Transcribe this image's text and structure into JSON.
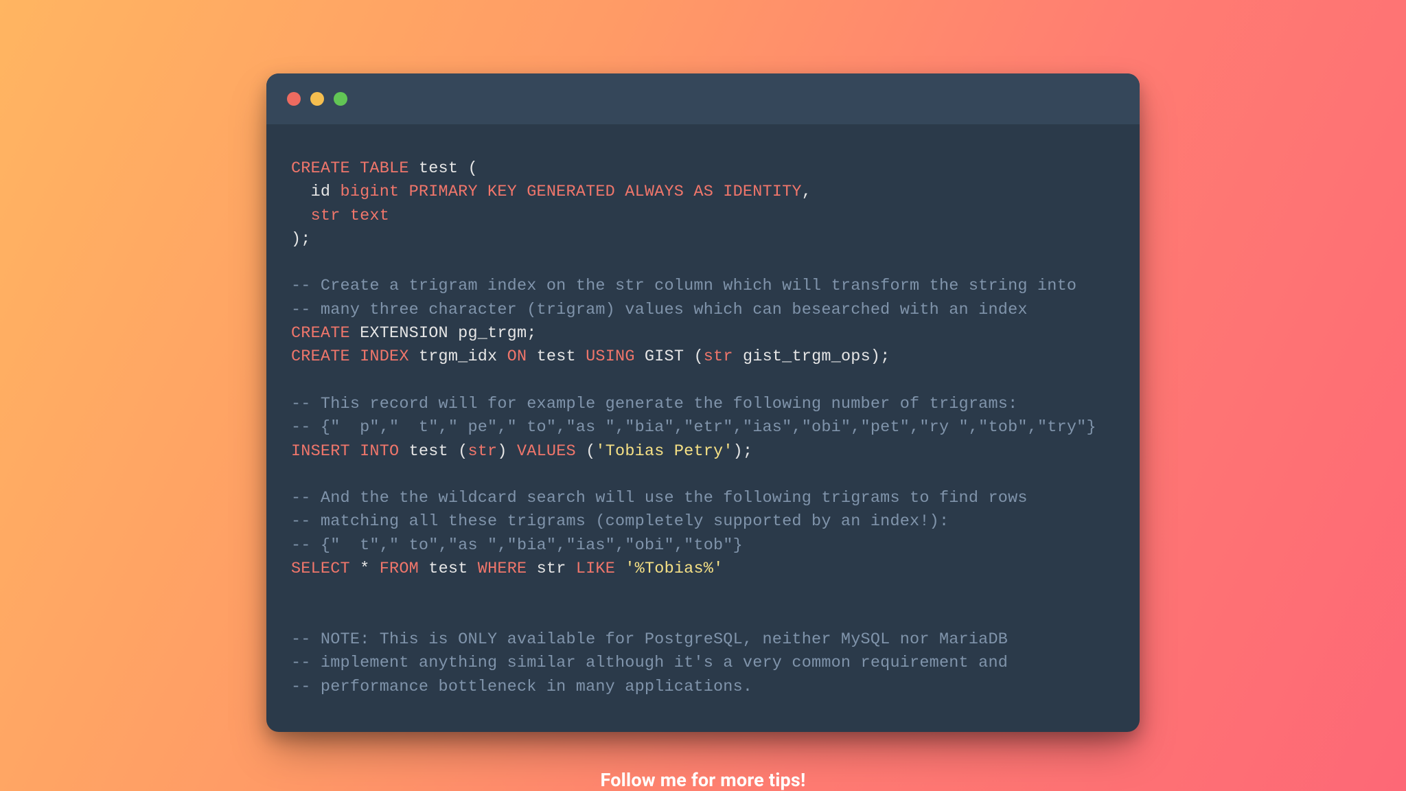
{
  "lines": [
    [
      [
        "kw",
        "CREATE TABLE"
      ],
      [
        "plain",
        " test ("
      ]
    ],
    [
      [
        "plain",
        "  id "
      ],
      [
        "kw",
        "bigint PRIMARY KEY GENERATED ALWAYS AS IDENTITY"
      ],
      [
        "plain",
        ","
      ]
    ],
    [
      [
        "plain",
        "  "
      ],
      [
        "kw",
        "str text"
      ]
    ],
    [
      [
        "plain",
        ");"
      ]
    ],
    [
      [
        "plain",
        ""
      ]
    ],
    [
      [
        "comment",
        "-- Create a trigram index on the str column which will transform the string into"
      ]
    ],
    [
      [
        "comment",
        "-- many three character (trigram) values which can besearched with an index"
      ]
    ],
    [
      [
        "kw",
        "CREATE"
      ],
      [
        "plain",
        " EXTENSION pg_trgm;"
      ]
    ],
    [
      [
        "kw",
        "CREATE INDEX"
      ],
      [
        "plain",
        " trgm_idx "
      ],
      [
        "kw",
        "ON"
      ],
      [
        "plain",
        " test "
      ],
      [
        "kw",
        "USING"
      ],
      [
        "plain",
        " GIST ("
      ],
      [
        "kw",
        "str"
      ],
      [
        "plain",
        " gist_trgm_ops);"
      ]
    ],
    [
      [
        "plain",
        ""
      ]
    ],
    [
      [
        "comment",
        "-- This record will for example generate the following number of trigrams:"
      ]
    ],
    [
      [
        "comment",
        "-- {\"  p\",\"  t\",\" pe\",\" to\",\"as \",\"bia\",\"etr\",\"ias\",\"obi\",\"pet\",\"ry \",\"tob\",\"try\"}"
      ]
    ],
    [
      [
        "kw",
        "INSERT INTO"
      ],
      [
        "plain",
        " test ("
      ],
      [
        "kw",
        "str"
      ],
      [
        "plain",
        ") "
      ],
      [
        "kw",
        "VALUES"
      ],
      [
        "plain",
        " ("
      ],
      [
        "str",
        "'Tobias Petry'"
      ],
      [
        "plain",
        ");"
      ]
    ],
    [
      [
        "plain",
        ""
      ]
    ],
    [
      [
        "comment",
        "-- And the the wildcard search will use the following trigrams to find rows"
      ]
    ],
    [
      [
        "comment",
        "-- matching all these trigrams (completely supported by an index!):"
      ]
    ],
    [
      [
        "comment",
        "-- {\"  t\",\" to\",\"as \",\"bia\",\"ias\",\"obi\",\"tob\"}"
      ]
    ],
    [
      [
        "kw",
        "SELECT"
      ],
      [
        "plain",
        " * "
      ],
      [
        "kw",
        "FROM"
      ],
      [
        "plain",
        " test "
      ],
      [
        "kw",
        "WHERE"
      ],
      [
        "plain",
        " str "
      ],
      [
        "kw",
        "LIKE"
      ],
      [
        "plain",
        " "
      ],
      [
        "str",
        "'%Tobias%'"
      ]
    ],
    [
      [
        "plain",
        ""
      ]
    ],
    [
      [
        "plain",
        ""
      ]
    ],
    [
      [
        "comment",
        "-- NOTE: This is ONLY available for PostgreSQL, neither MySQL nor MariaDB"
      ]
    ],
    [
      [
        "comment",
        "-- implement anything similar although it's a very common requirement and"
      ]
    ],
    [
      [
        "comment",
        "-- performance bottleneck in many applications."
      ]
    ]
  ],
  "footer": "Follow me for more tips!"
}
